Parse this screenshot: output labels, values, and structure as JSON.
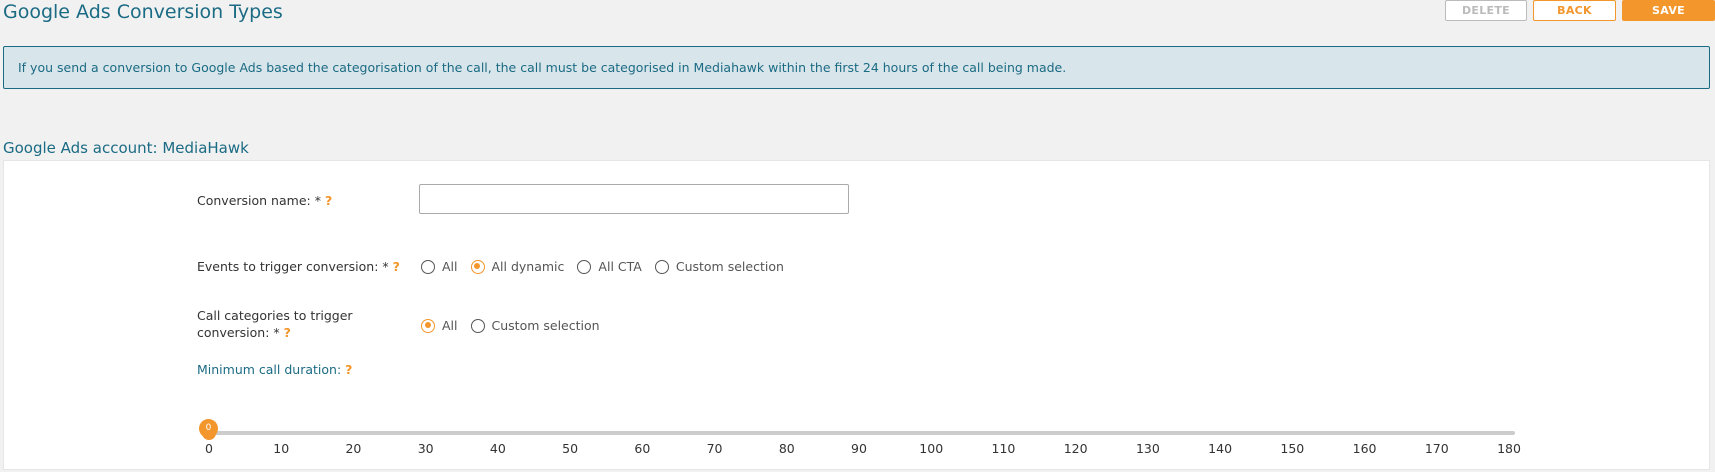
{
  "page": {
    "title": "Google Ads Conversion Types"
  },
  "toolbar": {
    "delete_label": "DELETE",
    "back_label": "BACK",
    "save_label": "SAVE"
  },
  "info": {
    "text": "If you send a conversion to Google Ads based the categorisation of the call, the call must be categorised in Mediahawk within the first 24 hours of the call being made."
  },
  "account": {
    "heading": "Google Ads account: MediaHawk"
  },
  "form": {
    "conversion_name": {
      "label": "Conversion name: *",
      "help": "?",
      "value": "",
      "placeholder": ""
    },
    "events": {
      "label": "Events to trigger conversion: *",
      "help": "?",
      "options": [
        {
          "label": "All",
          "checked": false
        },
        {
          "label": "All dynamic",
          "checked": true
        },
        {
          "label": "All CTA",
          "checked": false
        },
        {
          "label": "Custom selection",
          "checked": false
        }
      ]
    },
    "categories": {
      "label_line1": "Call categories to trigger",
      "label_line2": "conversion: *",
      "help": "?",
      "options": [
        {
          "label": "All",
          "checked": true
        },
        {
          "label": "Custom selection",
          "checked": false
        }
      ]
    },
    "min_duration": {
      "label": "Minimum call duration:",
      "help": "?",
      "value": "0",
      "min": 0,
      "max": 180,
      "ticks": [
        "0",
        "10",
        "20",
        "30",
        "40",
        "50",
        "60",
        "70",
        "80",
        "90",
        "100",
        "110",
        "120",
        "130",
        "140",
        "150",
        "160",
        "170",
        "180"
      ]
    }
  },
  "colors": {
    "accent": "#f3962c",
    "brand": "#1b6b84",
    "banner_bg": "#d8e5ea"
  }
}
